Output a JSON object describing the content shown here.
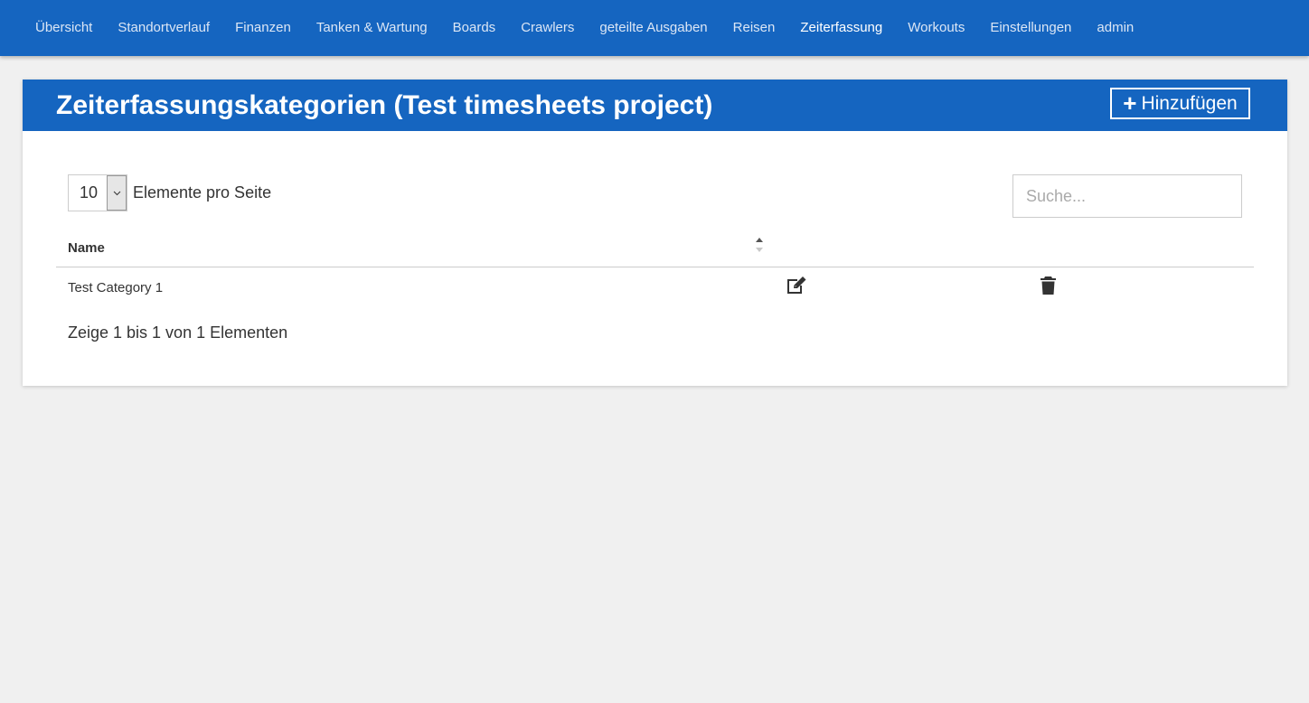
{
  "nav": {
    "items": [
      {
        "label": "Übersicht"
      },
      {
        "label": "Standortverlauf"
      },
      {
        "label": "Finanzen"
      },
      {
        "label": "Tanken & Wartung"
      },
      {
        "label": "Boards"
      },
      {
        "label": "Crawlers"
      },
      {
        "label": "geteilte Ausgaben"
      },
      {
        "label": "Reisen"
      },
      {
        "label": "Zeiterfassung"
      },
      {
        "label": "Workouts"
      },
      {
        "label": "Einstellungen"
      },
      {
        "label": "admin"
      }
    ],
    "active": "Zeiterfassung"
  },
  "page": {
    "title": "Zeiterfassungskategorien (Test timesheets project)",
    "add_label": "Hinzufügen"
  },
  "table_controls": {
    "page_size": "10",
    "page_size_label": "Elemente pro Seite",
    "search_placeholder": "Suche..."
  },
  "table": {
    "headers": {
      "name": "Name"
    },
    "rows": [
      {
        "name": "Test Category 1"
      }
    ],
    "info": "Zeige 1 bis 1 von 1 Elementen"
  },
  "icons": {
    "edit": "edit-icon",
    "delete": "trash-icon",
    "add": "plus-icon",
    "sort": "sort-icon"
  },
  "colors": {
    "primary": "#1565c0",
    "background": "#f0f0f0"
  }
}
